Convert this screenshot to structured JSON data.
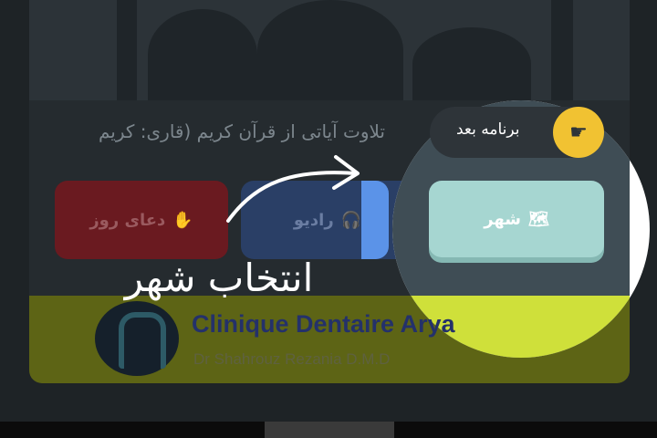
{
  "subtitle": "تلاوت آیاتی از قرآن کریم (قاری: کریم",
  "next_step": {
    "label": "برنامه بعد",
    "icon": "pointing-hand-icon"
  },
  "buttons": {
    "dua": {
      "label": "دعای روز",
      "icon": "praying-hands-icon"
    },
    "radio": {
      "label": "رادیو",
      "icon": "headphones-icon"
    },
    "city": {
      "label": "شهر",
      "icon": "map-icon"
    }
  },
  "hint": "انتخاب شهر",
  "banner": {
    "title": "Clinique Dentaire Arya",
    "subtitle": "Dr Shahrouz Rezania D.M.D"
  },
  "colors": {
    "spotlight_highlight": "#cfe03a",
    "next_accent": "#f1c232",
    "city_button": "#a6d6d1"
  }
}
